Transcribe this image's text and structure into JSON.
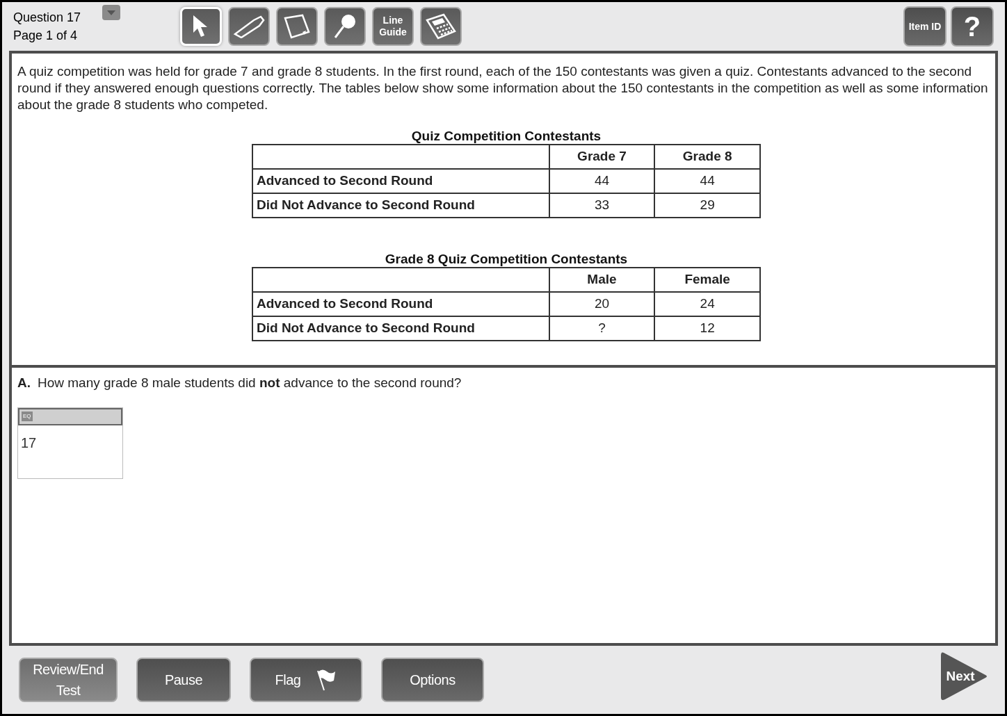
{
  "header": {
    "question": "Question 17",
    "page": "Page 1 of 4"
  },
  "tools": [
    {
      "kind": "pointer",
      "selected": true
    },
    {
      "kind": "highlighter",
      "selected": false
    },
    {
      "kind": "notepad",
      "selected": false
    },
    {
      "kind": "magnifier",
      "selected": false
    },
    {
      "kind": "line-guide",
      "label": "Line Guide",
      "selected": false
    },
    {
      "kind": "calculator",
      "selected": false
    }
  ],
  "right_buttons": [
    {
      "kind": "text",
      "label": "Item ID"
    },
    {
      "kind": "text",
      "label": "?"
    }
  ],
  "passage": "A quiz competition was held for grade 7 and grade 8 students. In the first round, each of the 150 contestants was given a quiz. Contestants advanced to the second round if they answered enough questions correctly. The tables below show some information about the 150 contestants in the competition as well as some information about the grade 8 students who competed.",
  "tables": [
    {
      "title": "Quiz Competition Contestants",
      "columns": [
        "",
        "Grade 7",
        "Grade 8"
      ],
      "rows": [
        [
          "Advanced to Second Round",
          "44",
          "44"
        ],
        [
          "Did Not Advance to Second Round",
          "33",
          "29"
        ]
      ]
    },
    {
      "title": "Grade 8 Quiz Competition Contestants",
      "columns": [
        "",
        "Male",
        "Female"
      ],
      "rows": [
        [
          "Advanced to Second Round",
          "20",
          "24"
        ],
        [
          "Did Not Advance to Second Round",
          "?",
          "12"
        ]
      ]
    }
  ],
  "question": {
    "label": "A.",
    "text": "How many grade 8 male students did **not** advance to the second round?",
    "editor_tool": "EQ",
    "answer": "17"
  },
  "footer": {
    "buttons": [
      {
        "label": "Review/End Test",
        "kind": "plain"
      },
      {
        "label": "Pause",
        "kind": "plain"
      },
      {
        "label": "Flag",
        "kind": "flag"
      },
      {
        "label": "Options",
        "kind": "plain"
      }
    ],
    "next": "Next"
  }
}
